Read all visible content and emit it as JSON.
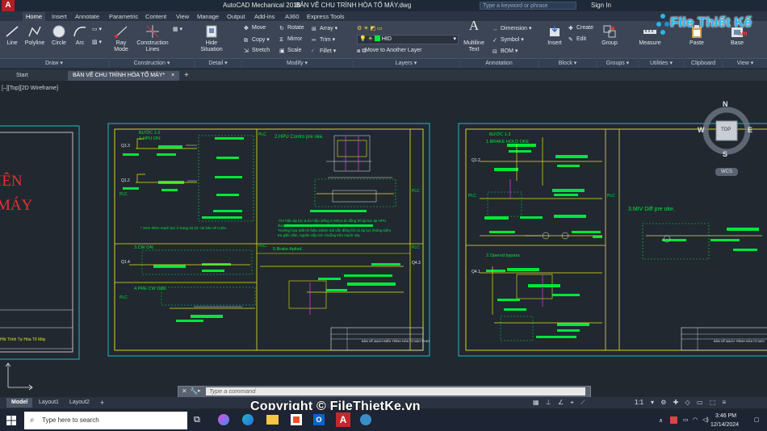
{
  "titlebar": {
    "app": "AutoCAD Mechanical 2018",
    "file": "BẢN VẼ CHU TRÌNH HÒA TỔ MÁY.dwg",
    "search_placeholder": "Type a keyword or phrase",
    "sign_in": "Sign In"
  },
  "ribbon_tabs": [
    "Home",
    "Insert",
    "Annotate",
    "Parametric",
    "Content",
    "View",
    "Manage",
    "Output",
    "Add-ins",
    "A360",
    "Express Tools"
  ],
  "draw": {
    "line": "Line",
    "polyline": "Polyline",
    "circle": "Circle",
    "arc": "Arc",
    "panel": "Draw ▾"
  },
  "construction": {
    "ray": "Ray",
    "mode": "Mode",
    "lines": "Construction Lines",
    "panel": "Construction ▾"
  },
  "detail": {
    "hide": "Hide Situation",
    "panel": "Detail ▾"
  },
  "modify": {
    "move": "Move",
    "rotate": "Rotate",
    "array": "Array",
    "copy": "Copy",
    "mirror": "Mirror",
    "trim": "Trim",
    "stretch": "Stretch",
    "scale": "Scale",
    "fillet": "Fillet",
    "panel": "Modify ▾"
  },
  "layers": {
    "current": "HID",
    "move_to": "Move to Another Layer",
    "panel": "Layers ▾"
  },
  "annotation": {
    "multiline": "Multiline Text",
    "dimension": "Dimension",
    "symbol": "Symbol",
    "bom": "BOM",
    "panel": "Annotation"
  },
  "block": {
    "insert": "Insert",
    "create": "Create",
    "edit": "Edit",
    "panel": "Block ▾"
  },
  "groups": {
    "group": "Group",
    "panel": "Groups ▾"
  },
  "utilities": {
    "measure": "Measure",
    "panel": "Utilities ▾"
  },
  "clipboard": {
    "paste": "Paste",
    "panel": "Clipboard"
  },
  "view": {
    "base": "Base",
    "panel": "View ▾"
  },
  "logo": {
    "text": "File Thiết Kế",
    "suffix": ".vn"
  },
  "doc_tabs": {
    "start": "Start",
    "drawing": "BẢN VẼ CHU TRÌNH HÒA TỔ MÁY*"
  },
  "viewport_label": "[–][Top][2D Wireframe]",
  "viewcube": {
    "n": "N",
    "s": "S",
    "e": "E",
    "w": "W",
    "top": "TOP",
    "wcs": "WCS"
  },
  "sheet_left": {
    "title1": "IÊN",
    "title2": "MÁY",
    "footer": "Hồi Trình Tự Hòa Tổ Máy"
  },
  "sheet_mid": {
    "step": "BƯỚC 1-2",
    "s1": "1.HPU ON:",
    "s2": "2.HPU Contro pre oke.",
    "s3": "3.CW ON:",
    "s4": "4.PRE CW OKE.",
    "s5": "5.Brake Aplied.",
    "note1": "* Xem thêm mạch lực ở trang 22,23 -32 bản vẽ 0,4kv.",
    "note2": "-Tín hiệu áp lực & tín hiệu xiếng 4-20mA từ đồng hồ áp lực tại HPU",
    "note3": "đưa về PLC,PLC quy đổi và thể hiện lên trên scada.",
    "note4": "Trường hợp mất tín hiệu 2oken mà vẫn đồng hồ có áp lực không kiểm",
    "note5": "tra giắc cắm, nguồn cấp mở chuỗng trên mạch này.",
    "q1": "Q1.3",
    "q2": "Q1.2",
    "q3": "Q1.4",
    "q4": "Q4.3",
    "plc": "PLC",
    "title_block": "BẢN VẼ MẠCH ĐIỆN TRÌNH HÒA TỔ MÁY PHÁT"
  },
  "sheet_right": {
    "step": "BƯỚC 1-3",
    "s1": "1.BRAKE HOLD OKE",
    "s2": "2.Operod bypass",
    "s3": "3.MIV Diff pre oke.",
    "q1": "Q1.2",
    "q2": "Q4.1",
    "plc": "PLC",
    "title_block": "BẢN VẼ MẠCH TRÌNH HÒA TỔ MÁY"
  },
  "command_placeholder": "Type a command",
  "layout_tabs": [
    "Model",
    "Layout1",
    "Layout2"
  ],
  "scale": "1:1",
  "copyright": "Copyright © FileThietKe.vn",
  "taskbar": {
    "search": "Type here to search",
    "time": "3:46 PM",
    "date": "12/14/2024"
  },
  "colors": {
    "green": "#00e63a",
    "yellow": "#e6e61e",
    "cyan": "#1fb8c8",
    "magenta": "#e040e0",
    "canvas": "#212830",
    "ribbon": "#3b4556"
  }
}
